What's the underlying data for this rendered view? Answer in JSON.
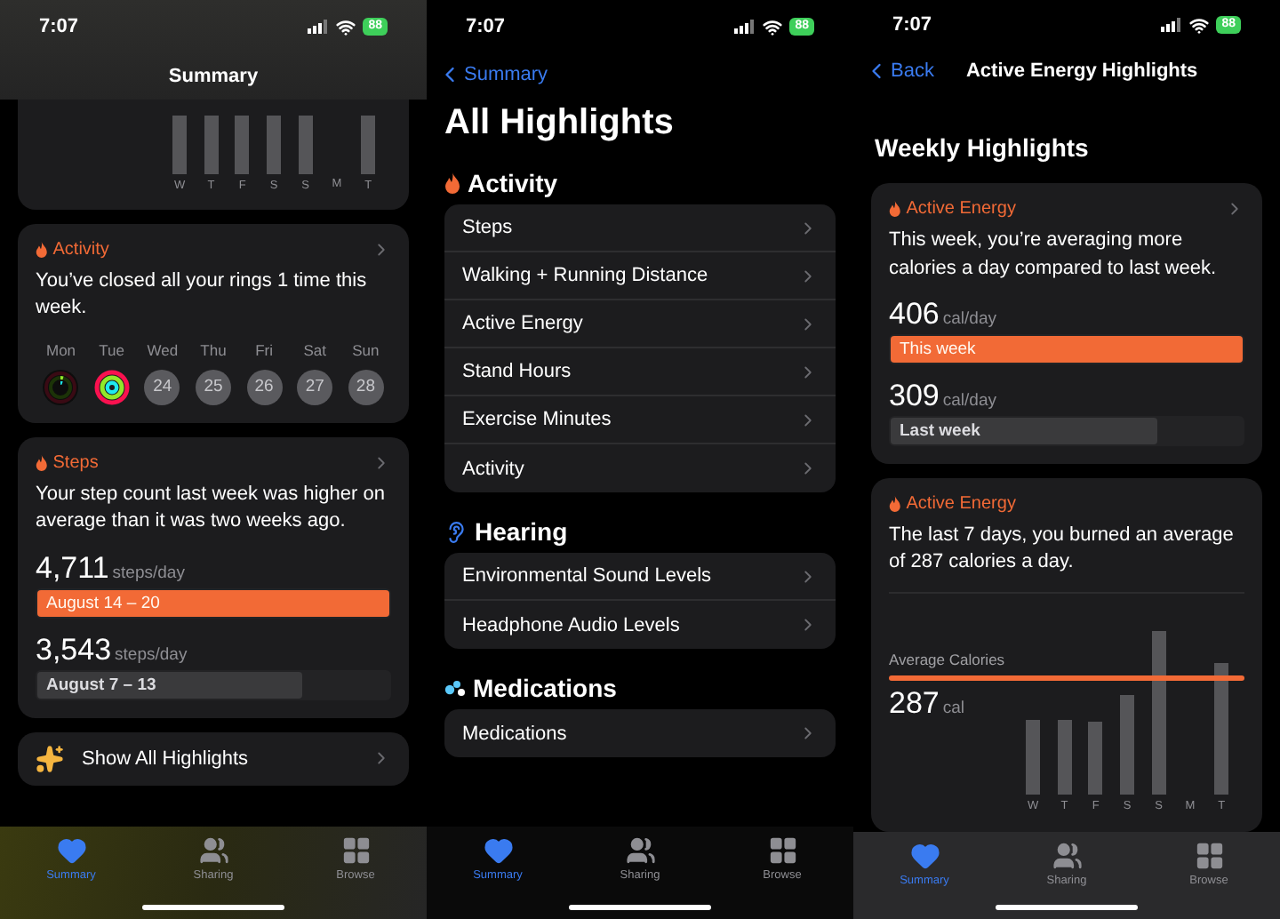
{
  "screens": [
    {
      "kind": "summary",
      "status": {
        "time": "7:07",
        "battery": "88"
      },
      "title": "Summary",
      "chart_days": [
        "W",
        "T",
        "F",
        "S",
        "S",
        "M",
        "T"
      ],
      "cards": [
        {
          "kind": "activity",
          "category": "Activity",
          "message": "You’ve closed all your rings 1 time this week.",
          "days": [
            {
              "label": "Mon",
              "kind": "rings",
              "closed": false
            },
            {
              "label": "Tue",
              "kind": "rings",
              "closed": true
            },
            {
              "label": "Wed",
              "kind": "date",
              "date": "24"
            },
            {
              "label": "Thu",
              "kind": "date",
              "date": "25"
            },
            {
              "label": "Fri",
              "kind": "date",
              "date": "26"
            },
            {
              "label": "Sat",
              "kind": "date",
              "date": "27"
            },
            {
              "label": "Sun",
              "kind": "date",
              "date": "28"
            }
          ]
        },
        {
          "kind": "comparison",
          "category": "Steps",
          "message": "Your step count last week was higher on average than it was two weeks ago.",
          "entries": [
            {
              "value": "4,711",
              "unit": "steps/day",
              "label": "August 14 – 20",
              "level": 1,
              "current": true
            },
            {
              "value": "3,543",
              "unit": "steps/day",
              "label": "August 7 – 13",
              "level": 0.75,
              "current": false
            }
          ]
        }
      ],
      "show_all": "Show All Highlights",
      "tabs": [
        {
          "kind": "summary",
          "label": "Summary",
          "selected": true
        },
        {
          "kind": "sharing",
          "label": "Sharing",
          "selected": false
        },
        {
          "kind": "browse",
          "label": "Browse",
          "selected": false
        }
      ]
    },
    {
      "kind": "list",
      "status": {
        "time": "7:07",
        "battery": "88"
      },
      "back": "Summary",
      "title": "All Highlights",
      "sections": [
        {
          "kind": "activity",
          "title": "Activity",
          "items": [
            "Steps",
            "Walking + Running Distance",
            "Active Energy",
            "Stand Hours",
            "Exercise Minutes",
            "Activity"
          ]
        },
        {
          "kind": "hearing",
          "title": "Hearing",
          "items": [
            "Environmental Sound Levels",
            "Headphone Audio Levels"
          ]
        },
        {
          "kind": "medications",
          "title": "Medications",
          "items": [
            "Medications"
          ]
        }
      ],
      "tabs": [
        {
          "kind": "summary",
          "label": "Summary",
          "selected": true
        },
        {
          "kind": "sharing",
          "label": "Sharing",
          "selected": false
        },
        {
          "kind": "browse",
          "label": "Browse",
          "selected": false
        }
      ]
    },
    {
      "kind": "detail",
      "status": {
        "time": "7:07",
        "battery": "88"
      },
      "back": "Back",
      "title": "Active Energy Highlights",
      "heading": "Weekly Highlights",
      "cards": [
        {
          "kind": "comparison",
          "category": "Active Energy",
          "message": "This week, you’re averaging more calories a day compared to last week.",
          "entries": [
            {
              "value": "406",
              "unit": "cal/day",
              "label": "This week",
              "level": 1,
              "current": true
            },
            {
              "value": "309",
              "unit": "cal/day",
              "label": "Last week",
              "level": 0.76,
              "current": false
            }
          ]
        },
        {
          "kind": "average",
          "category": "Active Energy",
          "message": "The last 7 days, you burned an average of 287 calories a day.",
          "average_label": "Average Calories",
          "value": "287",
          "unit": "cal",
          "chart_days": [
            "W",
            "T",
            "F",
            "S",
            "S",
            "M",
            "T"
          ]
        }
      ],
      "tabs": [
        {
          "kind": "summary",
          "label": "Summary",
          "selected": true
        },
        {
          "kind": "sharing",
          "label": "Sharing",
          "selected": false
        },
        {
          "kind": "browse",
          "label": "Browse",
          "selected": false
        }
      ]
    }
  ]
}
